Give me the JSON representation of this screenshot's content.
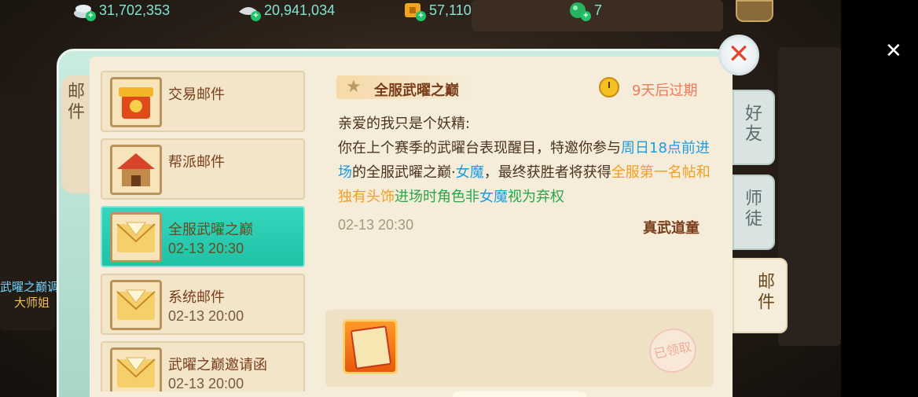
{
  "currencies": [
    {
      "icon": "silver-coins-icon",
      "value": "31,702,353"
    },
    {
      "icon": "silver-ingot-icon",
      "value": "20,941,034"
    },
    {
      "icon": "gold-coin-icon",
      "value": "57,110"
    },
    {
      "icon": "green-gem-icon",
      "value": "7"
    }
  ],
  "scene": {
    "npc_title": "武曜之巅调度弟子",
    "npc_name": "大师姐"
  },
  "panel": {
    "left_tab": "邮件",
    "right_tabs": [
      {
        "label": "好友",
        "active": false
      },
      {
        "label": "师徒",
        "active": false
      },
      {
        "label": "邮件",
        "active": true
      }
    ]
  },
  "mails": [
    {
      "title": "交易邮件",
      "date": "",
      "icon": "trade-mail-icon",
      "active": false
    },
    {
      "title": "帮派邮件",
      "date": "",
      "icon": "guild-mail-icon",
      "active": false
    },
    {
      "title": "全服武曜之巅",
      "date": "02-13 20:30",
      "icon": "envelope-icon",
      "active": true
    },
    {
      "title": "系统邮件",
      "date": "02-13 20:00",
      "icon": "envelope-icon",
      "active": false
    },
    {
      "title": "武曜之巅邀请函",
      "date": "02-13 20:00",
      "icon": "envelope-icon",
      "active": false
    }
  ],
  "detail": {
    "subject": "全服武曜之巅",
    "expire": "9天后过期",
    "greeting": "亲爱的我只是个妖精:",
    "body_parts": [
      {
        "text": "你在上个赛季的武曜台表现醒目，特邀你参与",
        "style": "normal"
      },
      {
        "text": "周日18点前进场",
        "style": "blue"
      },
      {
        "text": "的全服武曜之巅·",
        "style": "normal"
      },
      {
        "text": "女魔",
        "style": "blue"
      },
      {
        "text": "，最终获胜者将获得",
        "style": "normal"
      },
      {
        "text": "全服第一名帖和独有头饰",
        "style": "orange"
      },
      {
        "text": "进场时角色非",
        "style": "green"
      },
      {
        "text": "女魔",
        "style": "blue"
      },
      {
        "text": "视为弃权",
        "style": "green"
      }
    ],
    "time": "02-13 20:30",
    "sender": "真武道童",
    "attachment_icon": "invitation-card-icon",
    "claimed_label": "已领取"
  },
  "colors": {
    "accent": "#2ac9ae",
    "blue_text": "#1b9ce0",
    "green_text": "#2aa64a",
    "orange_text": "#f0a020",
    "expire_text": "#f07a5a"
  }
}
